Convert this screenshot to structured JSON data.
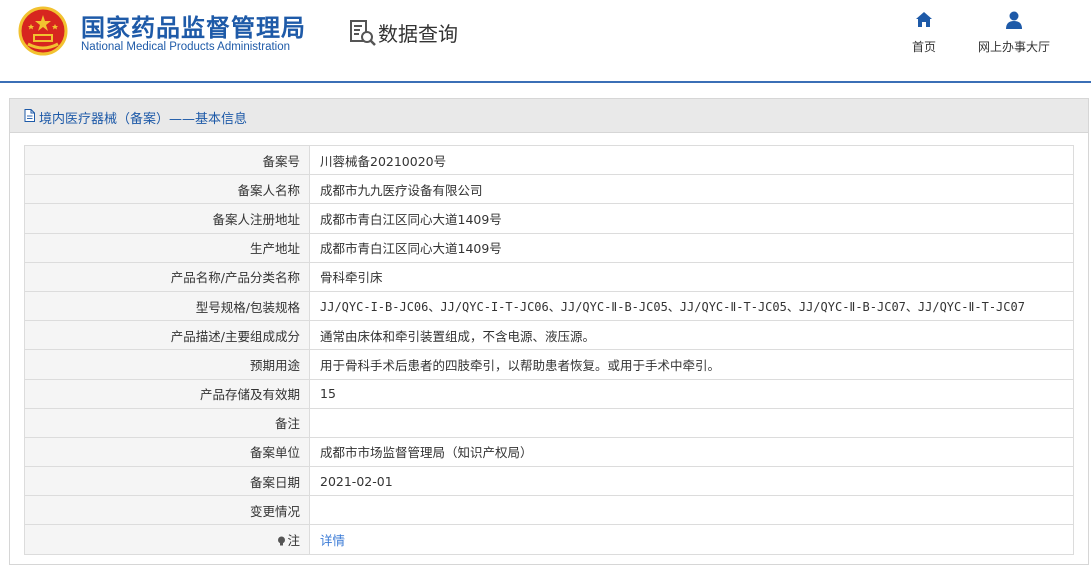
{
  "header": {
    "org_name_cn": "国家药品监督管理局",
    "org_name_en": "National Medical Products Administration",
    "query_title": "数据查询",
    "nav": {
      "home": "首页",
      "office": "网上办事大厅"
    }
  },
  "panel": {
    "title": "境内医疗器械（备案）——基本信息"
  },
  "rows": [
    {
      "label": "备案号",
      "value": "川蓉械备20210020号"
    },
    {
      "label": "备案人名称",
      "value": "成都市九九医疗设备有限公司"
    },
    {
      "label": "备案人注册地址",
      "value": "成都市青白江区同心大道1409号"
    },
    {
      "label": "生产地址",
      "value": "成都市青白江区同心大道1409号"
    },
    {
      "label": "产品名称/产品分类名称",
      "value": "骨科牵引床"
    },
    {
      "label": "型号规格/包装规格",
      "value": "JJ/QYC-I-B-JC06、JJ/QYC-I-T-JC06、JJ/QYC-Ⅱ-B-JC05、JJ/QYC-Ⅱ-T-JC05、JJ/QYC-Ⅱ-B-JC07、JJ/QYC-Ⅱ-T-JC07"
    },
    {
      "label": "产品描述/主要组成成分",
      "value": "通常由床体和牵引装置组成，不含电源、液压源。"
    },
    {
      "label": "预期用途",
      "value": "用于骨科手术后患者的四肢牵引，以帮助患者恢复。或用于手术中牵引。"
    },
    {
      "label": "产品存储及有效期",
      "value": "15"
    },
    {
      "label": "备注",
      "value": ""
    },
    {
      "label": "备案单位",
      "value": "成都市市场监督管理局（知识产权局）"
    },
    {
      "label": "备案日期",
      "value": "2021-02-01"
    },
    {
      "label": "变更情况",
      "value": ""
    },
    {
      "label": "注",
      "value": "详情"
    }
  ],
  "colors": {
    "brand_blue": "#1e5aa8",
    "link_blue": "#3b7bd6",
    "label_bg": "#f5f5f5",
    "header_line": "#3b6fb6"
  },
  "icons": {
    "emblem": "national-emblem-icon",
    "query": "document-search-icon",
    "home": "home-icon",
    "office": "user-icon",
    "panel": "document-icon",
    "note": "lightbulb-icon"
  }
}
